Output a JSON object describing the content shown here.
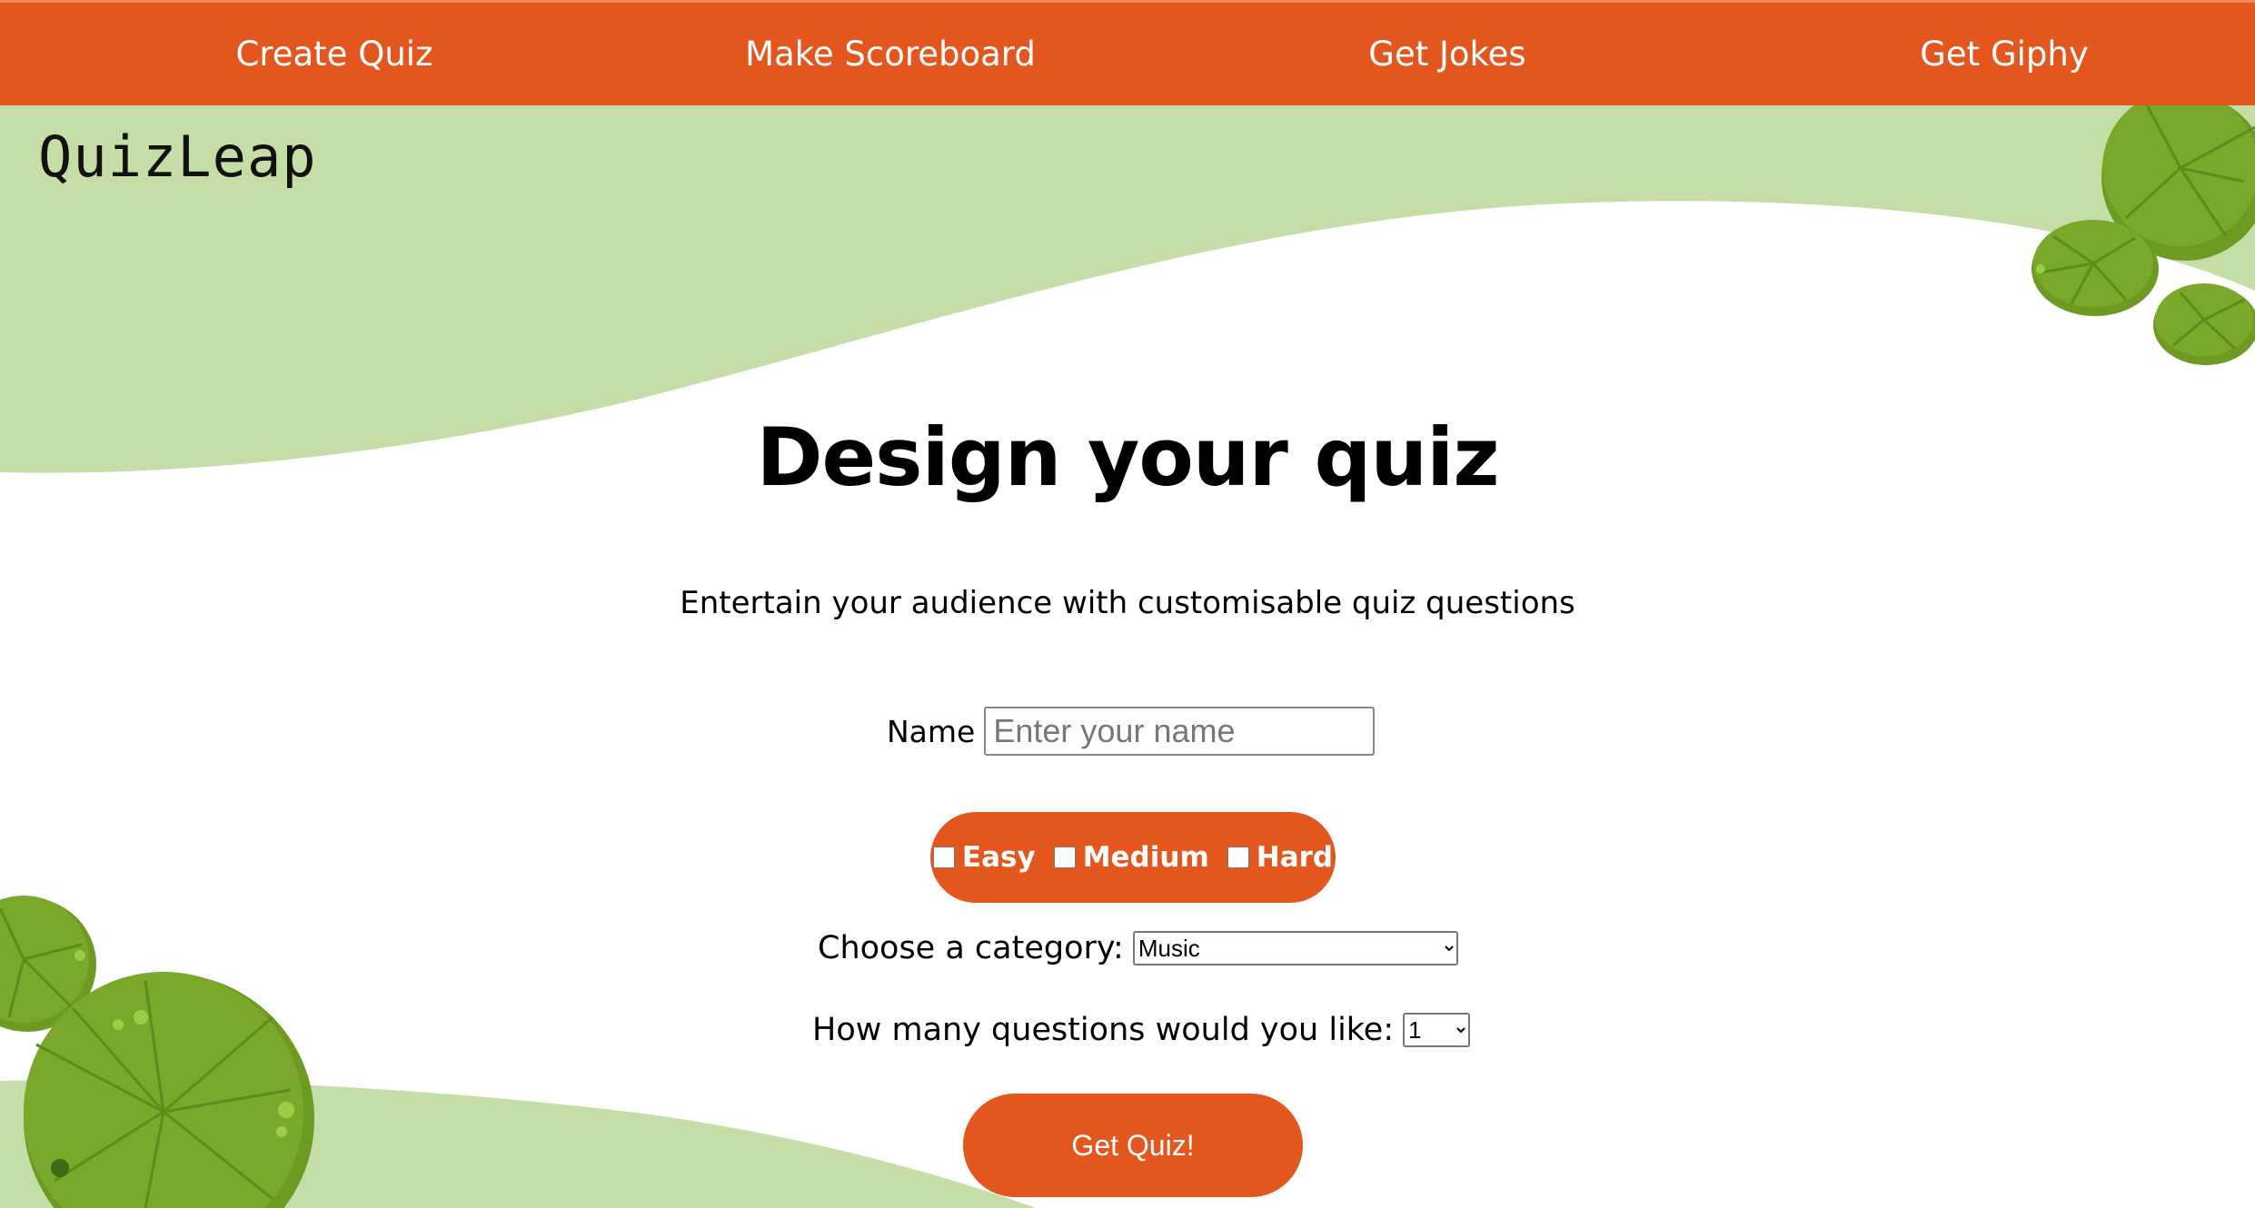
{
  "nav": {
    "items": [
      {
        "label": "Create Quiz"
      },
      {
        "label": "Make Scoreboard"
      },
      {
        "label": "Get Jokes"
      },
      {
        "label": "Get Giphy"
      }
    ]
  },
  "brand": {
    "logo_text": "QuizLeap"
  },
  "hero": {
    "title": "Design your quiz",
    "subtitle": "Entertain your audience with customisable quiz questions"
  },
  "form": {
    "name_label": "Name",
    "name_value": "",
    "name_placeholder": "Enter your name",
    "difficulty": {
      "options": [
        {
          "label": "Easy",
          "checked": false
        },
        {
          "label": "Medium",
          "checked": false
        },
        {
          "label": "Hard",
          "checked": false
        }
      ]
    },
    "category_label": "Choose a category:",
    "category_selected": "Music",
    "count_label": "How many questions would you like:",
    "count_selected": "1",
    "submit_label": "Get Quiz!"
  },
  "colors": {
    "accent": "#e3561e",
    "background_wave": "#c5dda7",
    "lily_pad": "#7aa82a",
    "lily_pad_light": "#8fbf35"
  },
  "icons": [
    "lily-pad-icon"
  ]
}
